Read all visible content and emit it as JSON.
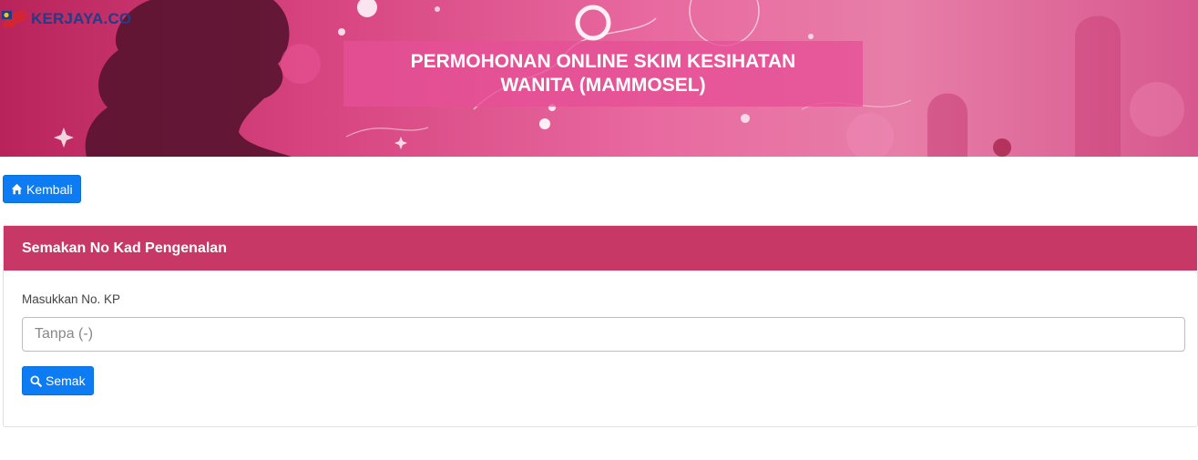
{
  "header": {
    "logo_text": "KERJAYA.CO",
    "title": "PERMOHONAN ONLINE SKIM KESIHATAN WANITA (MAMMOSEL)"
  },
  "nav": {
    "back_label": "Kembali",
    "back_icon": "home-icon"
  },
  "panel": {
    "heading": "Semakan No Kad Pengenalan",
    "field_label": "Masukkan No. KP",
    "input_placeholder": "Tanpa (-)",
    "input_value": "",
    "submit_label": "Semak",
    "submit_icon": "search-icon"
  },
  "colors": {
    "primary_button": "#0d7cf2",
    "panel_header": "#c73866",
    "banner_pink": "#d6427e"
  }
}
